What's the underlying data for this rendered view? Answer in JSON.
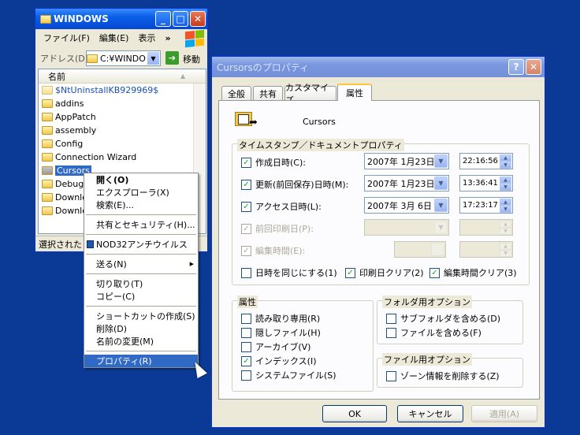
{
  "explorer": {
    "title": "WINDOWS",
    "menu": [
      "ファイル(F)",
      "編集(E)",
      "表示"
    ],
    "menu_more": "»",
    "address_label": "アドレス(D)",
    "address_value": "C:¥WINDO",
    "go_label": "移動",
    "column_name": "名前",
    "files": [
      "$NtUninstallKB929969$",
      "addins",
      "AppPatch",
      "assembly",
      "Config",
      "Connection Wizard",
      "Cursors",
      "Debug",
      "Downlo",
      "Downlo"
    ],
    "status": "選択された"
  },
  "context_menu": {
    "items": [
      {
        "label": "開く(O)",
        "bold": true
      },
      {
        "label": "エクスプローラ(X)"
      },
      {
        "label": "検索(E)..."
      },
      {
        "sep": true
      },
      {
        "label": "共有とセキュリティ(H)..."
      },
      {
        "sep": true
      },
      {
        "label": "NOD32アンチウイルス",
        "icon": true
      },
      {
        "sep": true
      },
      {
        "label": "送る(N)",
        "arrow": true
      },
      {
        "sep": true
      },
      {
        "label": "切り取り(T)"
      },
      {
        "label": "コピー(C)"
      },
      {
        "sep": true
      },
      {
        "label": "ショートカットの作成(S)"
      },
      {
        "label": "削除(D)"
      },
      {
        "label": "名前の変更(M)"
      },
      {
        "sep": true
      },
      {
        "label": "プロパティ(R)",
        "selected": true
      }
    ]
  },
  "props": {
    "title": "Cursorsのプロパティ",
    "help": "?",
    "tabs": [
      "全般",
      "共有",
      "カスタマイズ",
      "属性"
    ],
    "active_tab": "属性",
    "folder_name": "Cursors",
    "timestamp_group": "タイムスタンプ／ドキュメントプロパティ",
    "ts_rows": [
      {
        "label": "作成日時(C):",
        "checked": true,
        "enabled": true,
        "date": "2007年 1月23日",
        "time": "22:16:56"
      },
      {
        "label": "更新(前回保存)日時(M):",
        "checked": true,
        "enabled": true,
        "date": "2007年 1月23日",
        "time": "13:36:41"
      },
      {
        "label": "アクセス日時(L):",
        "checked": true,
        "enabled": true,
        "date": "2007年 3月 6日",
        "time": "17:23:17"
      },
      {
        "label": "前回印刷日(P):",
        "checked": true,
        "enabled": false,
        "date": "",
        "time": ""
      },
      {
        "label": "編集時間(E):",
        "checked": true,
        "enabled": false,
        "date": "",
        "time": ""
      }
    ],
    "opt_same": "日時を同じにする(1)",
    "opt_clear_print": "印刷日クリア(2)",
    "opt_clear_edit": "編集時間クリア(3)",
    "attr_group": "属性",
    "attrs": [
      {
        "label": "読み取り専用(R)",
        "checked": false
      },
      {
        "label": "隠しファイル(H)",
        "checked": false
      },
      {
        "label": "アーカイブ(V)",
        "checked": false
      },
      {
        "label": "インデックス(I)",
        "checked": true
      },
      {
        "label": "システムファイル(S)",
        "checked": false
      }
    ],
    "folder_opts_group": "フォルダ用オプション",
    "folder_opts": [
      "サブフォルダを含める(D)",
      "ファイルを含める(F)"
    ],
    "file_opts_group": "ファイル用オプション",
    "file_opts": [
      "ゾーン情報を削除する(Z)"
    ],
    "ok": "OK",
    "cancel": "キャンセル",
    "apply": "適用(A)"
  }
}
